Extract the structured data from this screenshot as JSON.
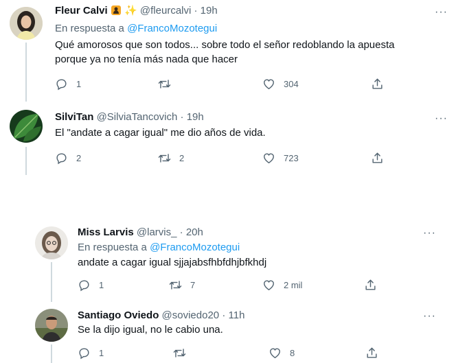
{
  "tweets": [
    {
      "name": "Fleur Calvi",
      "handle": "@fleurcalvi",
      "separator": "·",
      "time": "19h",
      "reply_prefix": "En respuesta a",
      "reply_handle": "@FrancoMozotegui",
      "text_line1": "Qué amorosos que son todos... sobre todo el señor redoblando la apuesta",
      "text_line2": "porque ya no tenía más nada que hacer",
      "replies": "1",
      "retweets": "",
      "likes": "304",
      "more": "···"
    },
    {
      "name": "SilviTan",
      "handle": "@SilviaTancovich",
      "separator": "·",
      "time": "19h",
      "text_line1": "El \"andate a cagar igual\" me dio años de vida.",
      "replies": "2",
      "retweets": "2",
      "likes": "723",
      "more": "···"
    },
    {
      "name": "Miss Larvis",
      "handle": "@larvis_",
      "separator": "·",
      "time": "20h",
      "reply_prefix": "En respuesta a",
      "reply_handle": "@FrancoMozotegui",
      "text_line1": "andate a cagar igual sjjajabsfhbfdhjbfkhdj",
      "replies": "1",
      "retweets": "7",
      "likes": "2 mil",
      "more": "···"
    },
    {
      "name": "Santiago Oviedo",
      "handle": "@soviedo20",
      "separator": "·",
      "time": "11h",
      "text_line1": "Se la dijo igual, no le cabio una.",
      "replies": "1",
      "retweets": "",
      "likes": "8",
      "more": "···"
    }
  ],
  "colors": {
    "text": "#0f1419",
    "secondary": "#536471",
    "link": "#1d9bf0",
    "thread": "#cfd9de"
  },
  "icons": [
    "reply-icon",
    "retweet-icon",
    "like-icon",
    "share-icon",
    "more-icon",
    "emoji-icon"
  ]
}
